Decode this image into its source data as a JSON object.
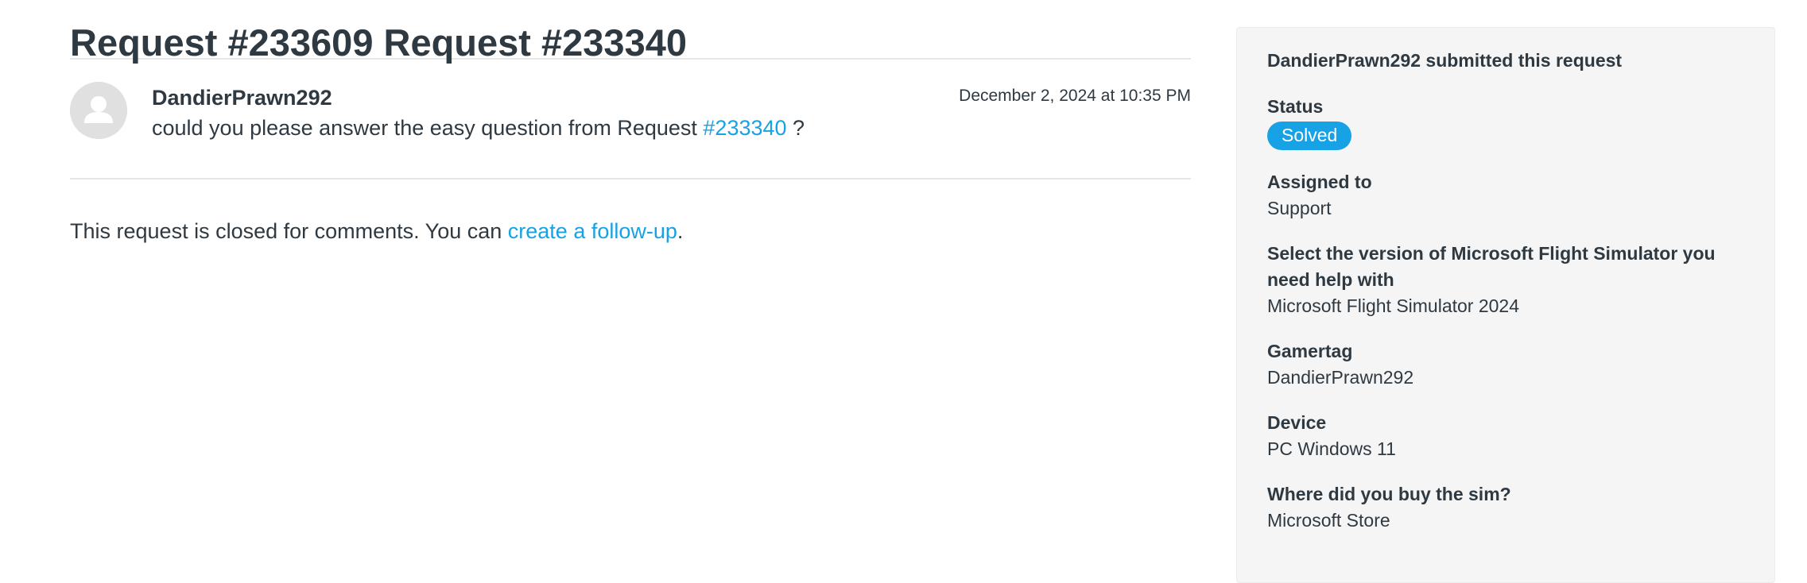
{
  "request": {
    "title": "Request #233609 Request #233340"
  },
  "comment": {
    "author": "DandierPrawn292",
    "date": "December 2, 2024 at 10:35 PM",
    "body_prefix": "could you please answer the easy question from Request ",
    "body_link": "#233340",
    "body_suffix": " ?"
  },
  "closed_note": {
    "prefix": "This request is closed for comments. You can ",
    "link": "create a follow-up",
    "suffix": "."
  },
  "sidebar": {
    "submitted_text": "DandierPrawn292 submitted this request",
    "status_label": "Status",
    "status_value": "Solved",
    "fields": [
      {
        "label": "Assigned to",
        "value": "Support"
      },
      {
        "label": "Select the version of Microsoft Flight Simulator you need help with",
        "value": "Microsoft Flight Simulator 2024"
      },
      {
        "label": "Gamertag",
        "value": "DandierPrawn292"
      },
      {
        "label": "Device",
        "value": "PC Windows 11"
      },
      {
        "label": "Where did you buy the sim?",
        "value": "Microsoft Store"
      }
    ]
  },
  "colors": {
    "link": "#17a2e5",
    "badge": "#17a2e5",
    "sidebar_bg": "#f5f5f5",
    "text": "#2f3941"
  },
  "icons": {
    "avatar": "default-user-avatar-icon"
  }
}
